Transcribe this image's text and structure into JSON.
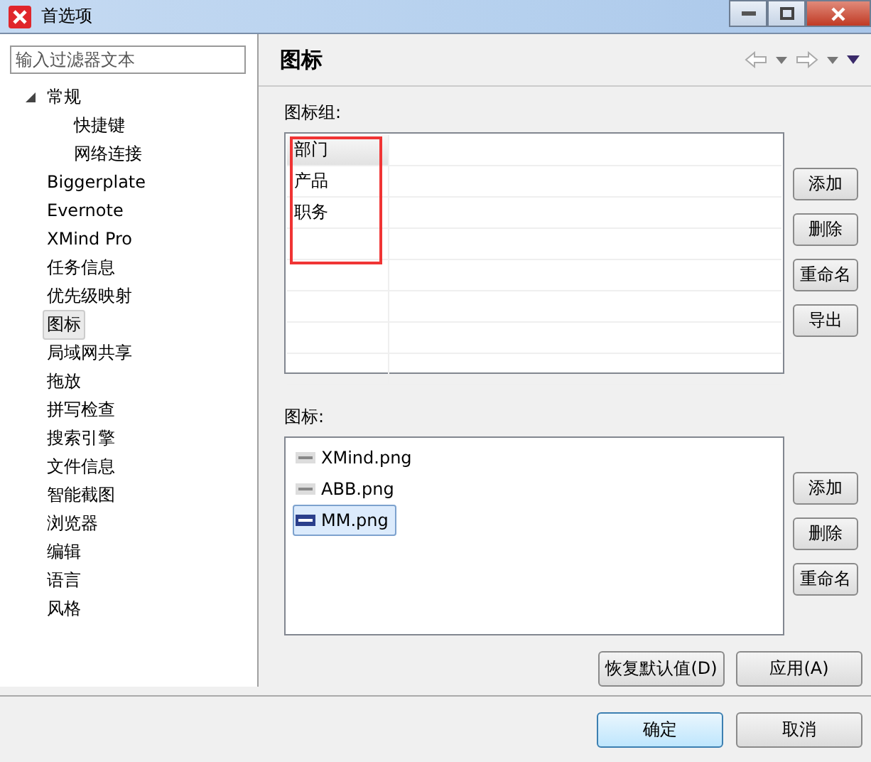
{
  "window": {
    "title": "首选项"
  },
  "filter": {
    "placeholder": "输入过滤器文本"
  },
  "tree": [
    {
      "label": "常规",
      "expanded": true,
      "selected": false,
      "children": [
        {
          "label": "快捷键",
          "selected": false
        },
        {
          "label": "网络连接",
          "selected": false
        }
      ]
    },
    {
      "label": "Biggerplate",
      "selected": false
    },
    {
      "label": "Evernote",
      "selected": false
    },
    {
      "label": "XMind Pro",
      "selected": false
    },
    {
      "label": "任务信息",
      "selected": false
    },
    {
      "label": "优先级映射",
      "selected": false
    },
    {
      "label": "图标",
      "selected": true
    },
    {
      "label": "局域网共享",
      "selected": false
    },
    {
      "label": "拖放",
      "selected": false
    },
    {
      "label": "拼写检查",
      "selected": false
    },
    {
      "label": "搜索引擎",
      "selected": false
    },
    {
      "label": "文件信息",
      "selected": false
    },
    {
      "label": "智能截图",
      "selected": false
    },
    {
      "label": "浏览器",
      "selected": false
    },
    {
      "label": "编辑",
      "selected": false
    },
    {
      "label": "语言",
      "selected": false
    },
    {
      "label": "风格",
      "selected": false
    }
  ],
  "page_title": "图标",
  "groups": {
    "label": "图标组:",
    "rows": [
      {
        "name": "部门",
        "selected": true
      },
      {
        "name": "产品",
        "selected": false
      },
      {
        "name": "职务",
        "selected": false
      }
    ],
    "buttons": [
      "添加",
      "删除",
      "重命名",
      "导出"
    ]
  },
  "icons": {
    "label": "图标:",
    "items": [
      {
        "name": "XMind.png",
        "selected": false
      },
      {
        "name": "ABB.png",
        "selected": false
      },
      {
        "name": "MM.png",
        "selected": true
      }
    ],
    "buttons": [
      "添加",
      "删除",
      "重命名"
    ]
  },
  "page_buttons": [
    "恢复默认值(D)",
    "应用(A)"
  ],
  "dialog_buttons": [
    {
      "label": "确定",
      "default": true
    },
    {
      "label": "取消",
      "default": false
    }
  ]
}
